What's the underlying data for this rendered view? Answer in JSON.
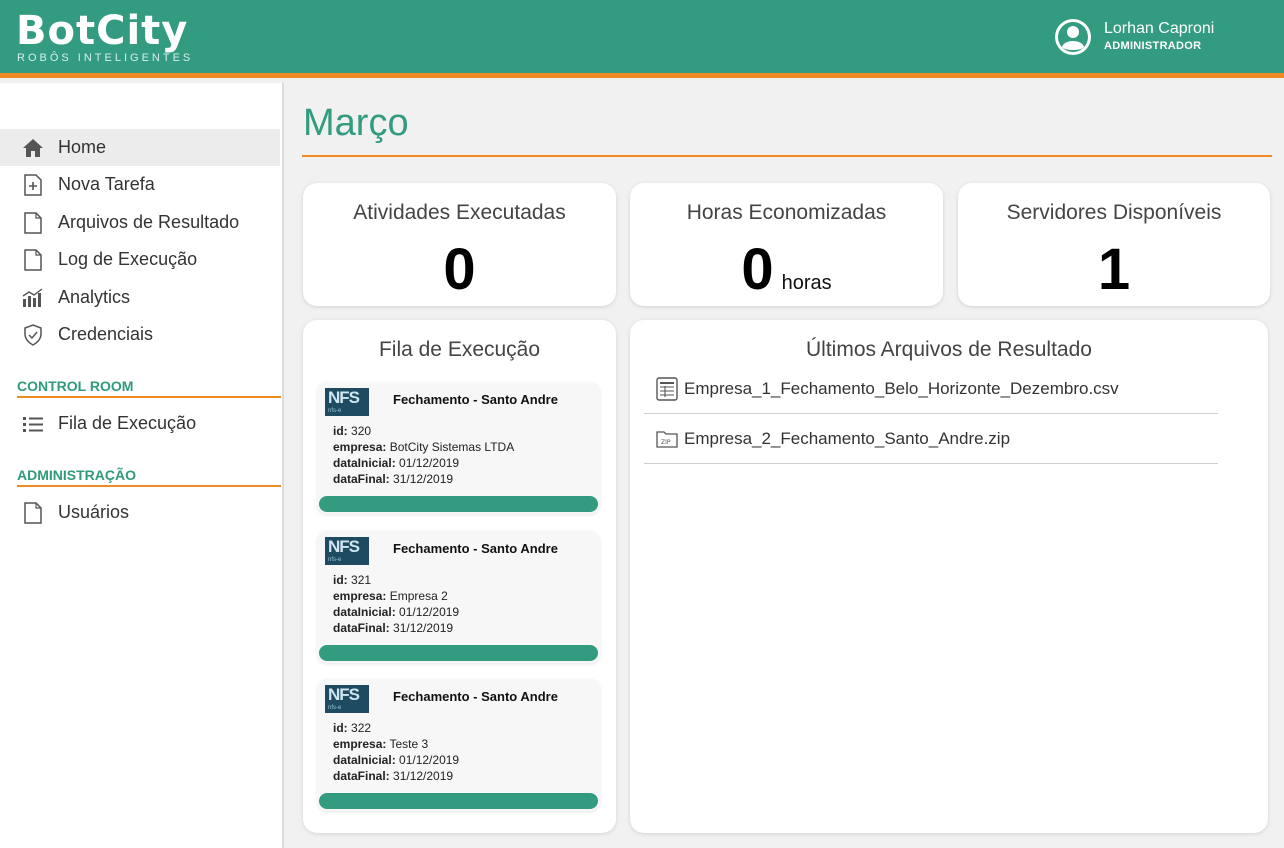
{
  "header": {
    "logo_text": "BotCity",
    "logo_tagline": "ROBÔS INTELIGENTES",
    "user_name": "Lorhan Caproni",
    "user_role": "ADMINISTRADOR"
  },
  "sidebar": {
    "items": [
      {
        "label": "Home",
        "icon": "home-icon",
        "active": true
      },
      {
        "label": "Nova Tarefa",
        "icon": "file-plus-icon"
      },
      {
        "label": "Arquivos de Resultado",
        "icon": "file-icon"
      },
      {
        "label": "Log de Execução",
        "icon": "file-icon"
      },
      {
        "label": "Analytics",
        "icon": "bar-chart-icon"
      },
      {
        "label": "Credenciais",
        "icon": "shield-icon"
      }
    ],
    "control_room_title": "CONTROL ROOM",
    "control_room_items": [
      {
        "label": "Fila de Execução",
        "icon": "list-icon"
      }
    ],
    "admin_title": "ADMINISTRAÇÃO",
    "admin_items": [
      {
        "label": "Usuários",
        "icon": "file-icon"
      }
    ]
  },
  "main": {
    "title": "Março",
    "stats": [
      {
        "label": "Atividades Executadas",
        "value": "0",
        "unit": ""
      },
      {
        "label": "Horas Economizadas",
        "value": "0",
        "unit": "horas"
      },
      {
        "label": "Servidores Disponíveis",
        "value": "1",
        "unit": ""
      }
    ],
    "queue": {
      "title": "Fila de Execução",
      "items": [
        {
          "logo": "NFS",
          "logo_sub": "nfs-e",
          "title": "Fechamento - Santo Andre",
          "id_label": "id:",
          "id": "320",
          "empresa_label": "empresa:",
          "empresa": "BotCity Sistemas LTDA",
          "dataInicial_label": "dataInicial:",
          "dataInicial": "01/12/2019",
          "dataFinal_label": "dataFinal:",
          "dataFinal": "31/12/2019"
        },
        {
          "logo": "NFS",
          "logo_sub": "nfs-e",
          "title": "Fechamento - Santo Andre",
          "id_label": "id:",
          "id": "321",
          "empresa_label": "empresa:",
          "empresa": "Empresa 2",
          "dataInicial_label": "dataInicial:",
          "dataInicial": "01/12/2019",
          "dataFinal_label": "dataFinal:",
          "dataFinal": "31/12/2019"
        },
        {
          "logo": "NFS",
          "logo_sub": "nfs-e",
          "title": "Fechamento - Santo Andre",
          "id_label": "id:",
          "id": "322",
          "empresa_label": "empresa:",
          "empresa": "Teste 3",
          "dataInicial_label": "dataInicial:",
          "dataInicial": "01/12/2019",
          "dataFinal_label": "dataFinal:",
          "dataFinal": "31/12/2019"
        }
      ]
    },
    "files": {
      "title": "Últimos Arquivos de Resultado",
      "items": [
        {
          "name": "Empresa_1_Fechamento_Belo_Horizonte_Dezembro.csv",
          "icon": "spreadsheet-file-icon"
        },
        {
          "name": "Empresa_2_Fechamento_Santo_Andre.zip",
          "icon": "zip-file-icon"
        }
      ]
    }
  },
  "colors": {
    "brand_green": "#329b80",
    "accent_orange": "#f08a24"
  }
}
